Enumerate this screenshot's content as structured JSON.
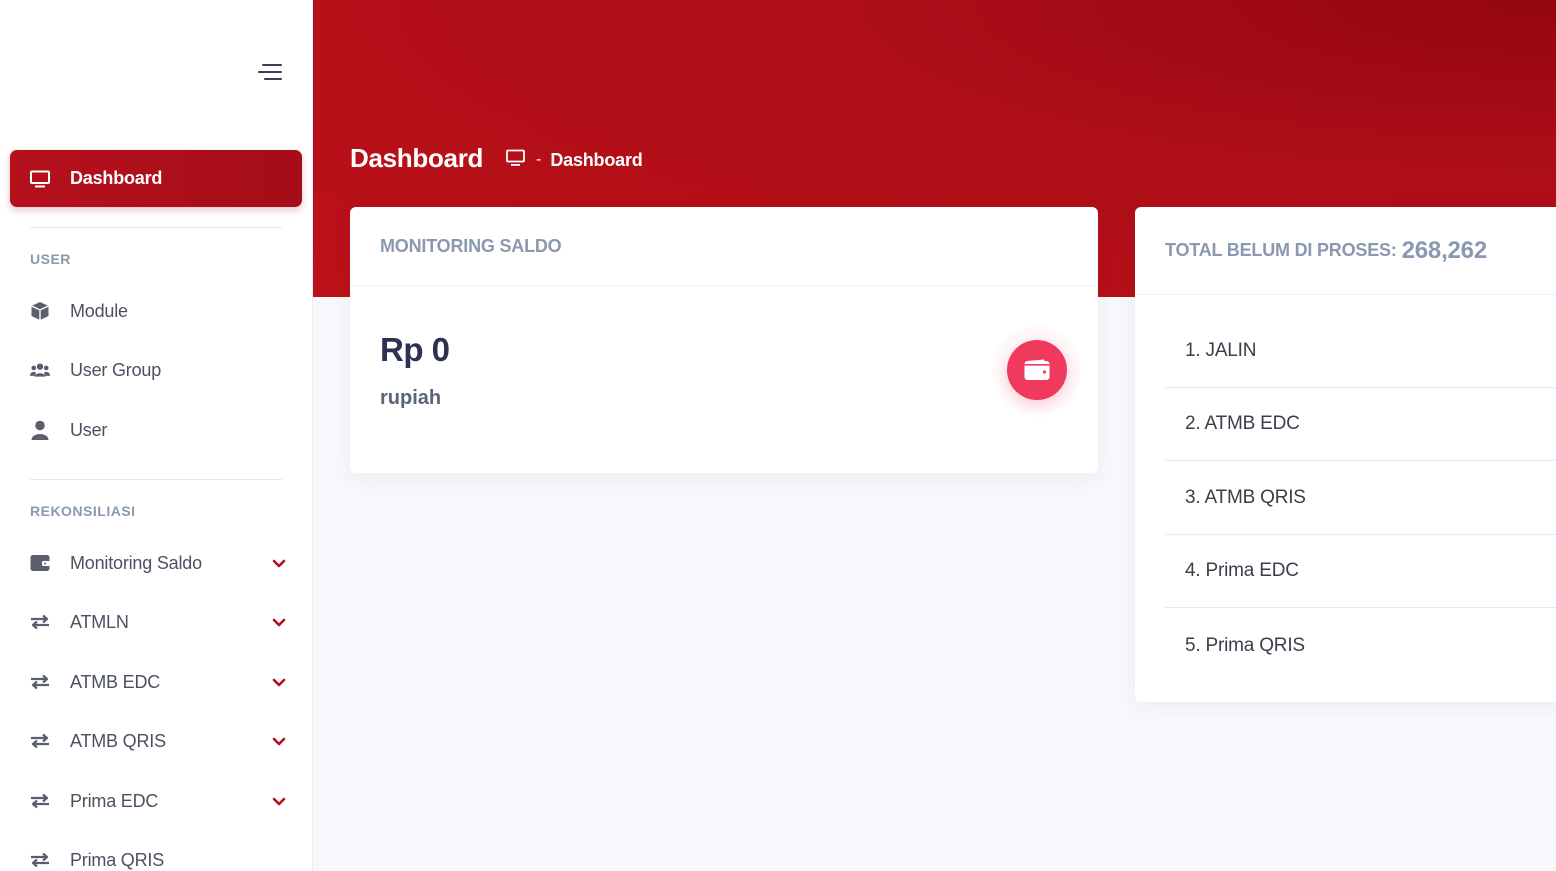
{
  "sidebar": {
    "active_item": {
      "label": "Dashboard",
      "icon": "monitor-icon"
    },
    "sections": [
      {
        "label": "USER",
        "items": [
          {
            "label": "Module",
            "icon": "box-icon"
          },
          {
            "label": "User Group",
            "icon": "users-icon"
          },
          {
            "label": "User",
            "icon": "user-icon"
          }
        ]
      },
      {
        "label": "REKONSILIASI",
        "items": [
          {
            "label": "Monitoring Saldo",
            "icon": "wallet-icon",
            "expandable": true
          },
          {
            "label": "ATMLN",
            "icon": "exchange-icon",
            "expandable": true
          },
          {
            "label": "ATMB EDC",
            "icon": "exchange-icon",
            "expandable": true
          },
          {
            "label": "ATMB QRIS",
            "icon": "exchange-icon",
            "expandable": true
          },
          {
            "label": "Prima EDC",
            "icon": "exchange-icon",
            "expandable": true
          },
          {
            "label": "Prima QRIS",
            "icon": "exchange-icon",
            "expandable": true
          }
        ]
      }
    ]
  },
  "header": {
    "title": "Dashboard",
    "breadcrumb": {
      "separator": "-",
      "current": "Dashboard"
    }
  },
  "saldo_card": {
    "title": "MONITORING SALDO",
    "amount": "Rp 0",
    "currency": "rupiah"
  },
  "total_card": {
    "title": "TOTAL BELUM DI PROSES:",
    "count": "268,262",
    "items": [
      "1. JALIN",
      "2. ATMB EDC",
      "3. ATMB QRIS",
      "4. Prima EDC",
      "5. Prima QRIS"
    ]
  },
  "colors": {
    "brand_red": "#b5101c",
    "wallet_pink": "#ef3a5d",
    "muted_label": "#8a98b0"
  }
}
